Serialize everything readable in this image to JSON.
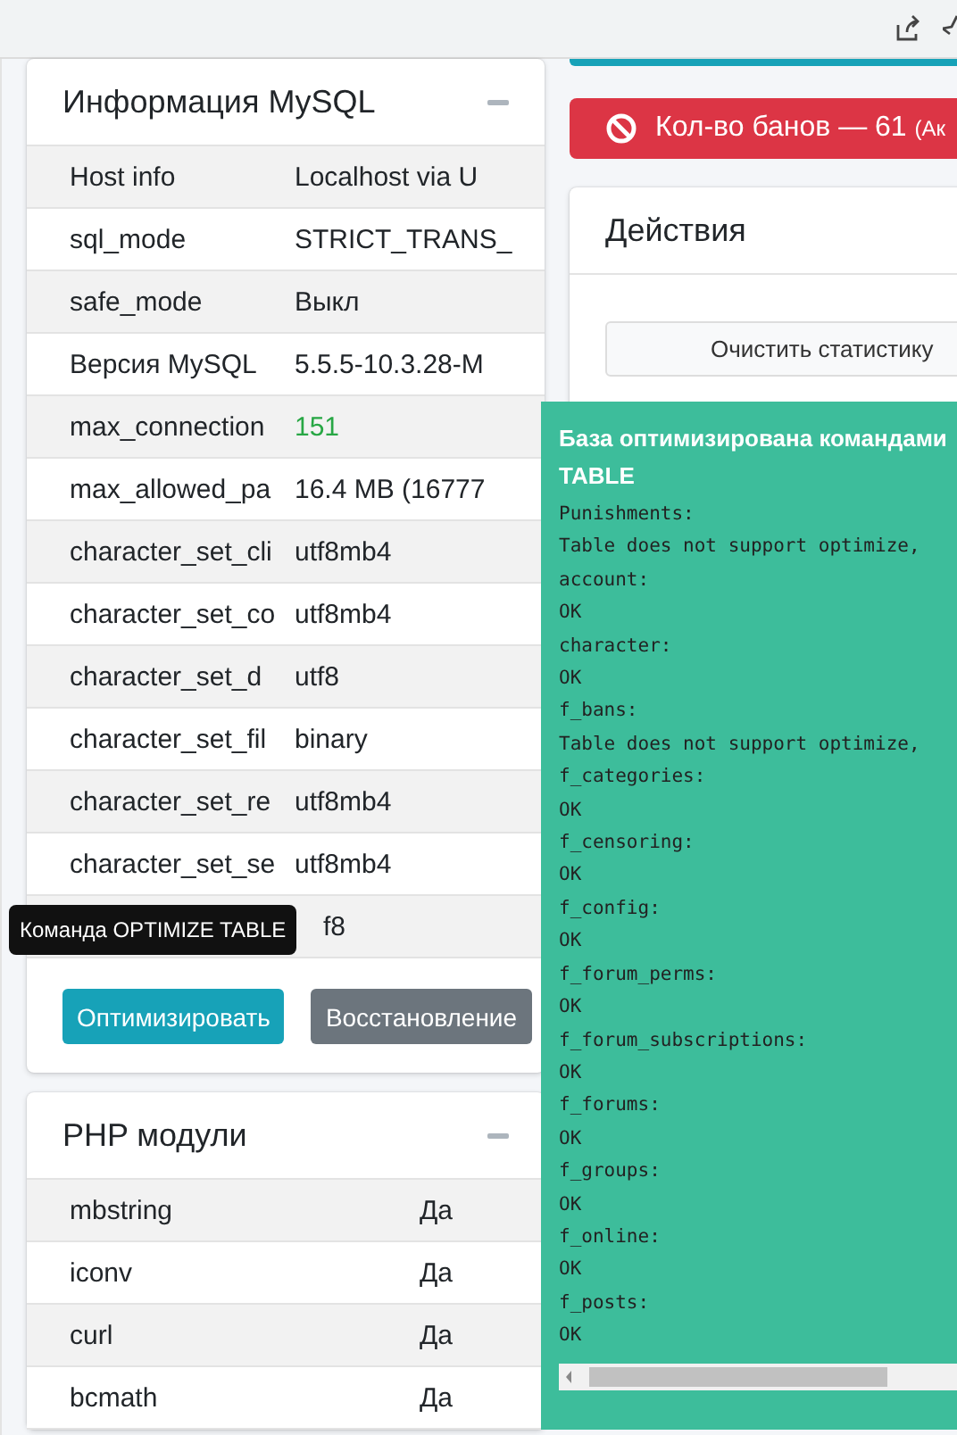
{
  "mysql_card": {
    "title": "Информация MySQL",
    "rows": [
      {
        "label": "Host info",
        "value": "Localhost via U",
        "kind": "text"
      },
      {
        "label": "sql_mode",
        "value": "STRICT_TRANS_",
        "kind": "text"
      },
      {
        "label": "safe_mode",
        "value": "Выкл",
        "kind": "text"
      },
      {
        "label": "Версия MySQL",
        "value": "5.5.5-10.3.28-M",
        "kind": "text"
      },
      {
        "label": "max_connection",
        "value": "151",
        "kind": "good"
      },
      {
        "label": "max_allowed_pa",
        "value": "16.4 MB (16777",
        "kind": "text"
      },
      {
        "label": "character_set_cli",
        "value": "utf8mb4",
        "kind": "text"
      },
      {
        "label": "character_set_co",
        "value": "utf8mb4",
        "kind": "text"
      },
      {
        "label": "character_set_d",
        "value": "utf8",
        "kind": "text"
      },
      {
        "label": "character_set_fil",
        "value": "binary",
        "kind": "text"
      },
      {
        "label": "character_set_re",
        "value": "utf8mb4",
        "kind": "text"
      },
      {
        "label": "character_set_se",
        "value": "utf8mb4",
        "kind": "text"
      },
      {
        "value": "f8",
        "kind": "text"
      }
    ],
    "tooltip": "Команда OPTIMIZE TABLE",
    "buttons": [
      {
        "label": "Оптимизировать",
        "kind": "info"
      },
      {
        "label": "Восстановление",
        "kind": "secondary"
      }
    ]
  },
  "php_card": {
    "title": "PHP модули",
    "rows": [
      {
        "label": "mbstring",
        "value": "Да"
      },
      {
        "label": "iconv",
        "value": "Да"
      },
      {
        "label": "curl",
        "value": "Да"
      },
      {
        "label": "bcmath",
        "value": "Да"
      }
    ]
  },
  "ban_alert": {
    "text": "Кол-во банов — 61",
    "suffix": "(Ак"
  },
  "actions_card": {
    "title": "Действия",
    "buttons": [
      "Очистить статистику"
    ]
  },
  "toast": {
    "title": "База оптимизирована командами",
    "title_cont": "TABLE",
    "log": [
      "Punishments:",
      "Table does not support optimize,",
      "account:",
      "OK",
      "character:",
      "OK",
      "f_bans:",
      "Table does not support optimize,",
      "f_categories:",
      "OK",
      "f_censoring:",
      "OK",
      "f_config:",
      "OK",
      "f_forum_perms:",
      "OK",
      "f_forum_subscriptions:",
      "OK",
      "f_forums:",
      "OK",
      "f_groups:",
      "OK",
      "f_online:",
      "OK",
      "f_posts:",
      "OK"
    ]
  }
}
